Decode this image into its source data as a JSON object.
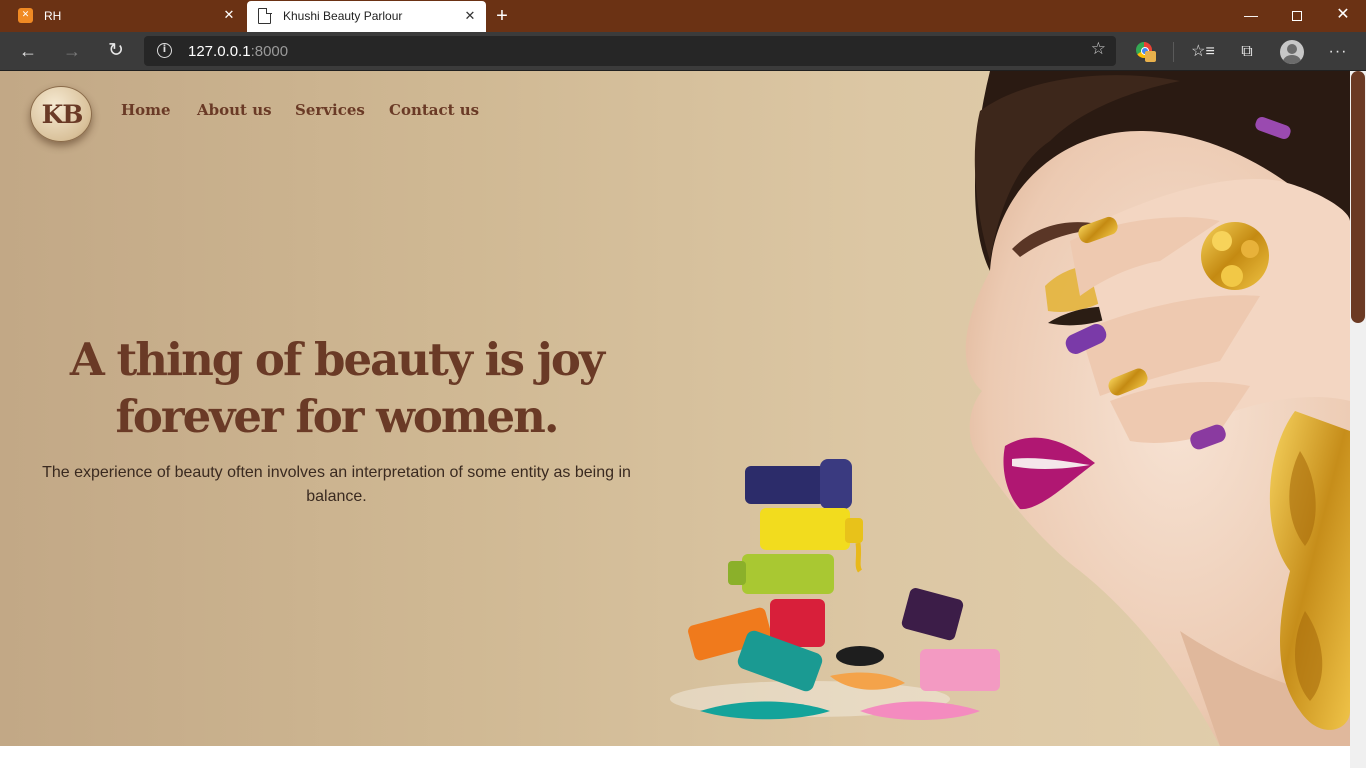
{
  "browser": {
    "tabs": [
      {
        "title": "RH",
        "favicon": "xampp-icon",
        "active": false
      },
      {
        "title": "Khushi Beauty Parlour",
        "favicon": "page-icon",
        "active": true
      }
    ],
    "address": {
      "host": "127.0.0.1",
      "port": ":8000"
    },
    "colors": {
      "tabbar": "#6b3214",
      "toolbar": "#3b3b3b",
      "address_bg": "#262626"
    }
  },
  "site": {
    "logo_text": "KB",
    "nav": [
      "Home",
      "About us",
      "Services",
      "Contact us"
    ],
    "hero": {
      "headline_line1": "A thing of beauty is joy",
      "headline_line2": "forever for women.",
      "subtext": "The experience of beauty often involves an interpretation of some entity as being in balance."
    },
    "colors": {
      "brand_text": "#6a3a26",
      "hero_bg": "#d0b994",
      "scroll_thumb": "#6b3a24"
    }
  }
}
